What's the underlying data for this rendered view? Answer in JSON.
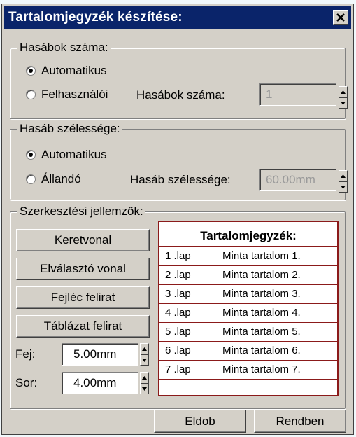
{
  "dialog": {
    "title": "Tartalomjegyzék készítése:",
    "close_label": "×"
  },
  "columns_group": {
    "label": "Hasábok száma:",
    "option_auto": "Automatikus",
    "option_user": "Felhasználói",
    "count_label": "Hasábok száma:",
    "count_value": "1",
    "selected": "Automatikus"
  },
  "width_group": {
    "label": "Hasáb szélessége:",
    "option_auto": "Automatikus",
    "option_fixed": "Állandó",
    "width_label": "Hasáb szélessége:",
    "width_value": "60.00mm",
    "selected": "Automatikus"
  },
  "edit_group": {
    "label": "Szerkesztési jellemzők:",
    "frame_line_button": "Keretvonal",
    "separator_line_button": "Elválasztó vonal",
    "header_caption_button": "Fejléc felirat",
    "table_caption_button": "Táblázat felirat",
    "head_label": "Fej:",
    "head_value": "5.00mm",
    "row_label": "Sor:",
    "row_value": "4.00mm"
  },
  "preview": {
    "title": "Tartalomjegyzék:",
    "rows": [
      {
        "page": "1 .lap",
        "content": "Minta tartalom 1."
      },
      {
        "page": "2 .lap",
        "content": "Minta tartalom 2."
      },
      {
        "page": "3 .lap",
        "content": "Minta tartalom 3."
      },
      {
        "page": "4 .lap",
        "content": "Minta tartalom 4."
      },
      {
        "page": "5 .lap",
        "content": "Minta tartalom 5."
      },
      {
        "page": "6 .lap",
        "content": "Minta tartalom 6."
      },
      {
        "page": "7 .lap",
        "content": "Minta tartalom 7."
      }
    ]
  },
  "footer": {
    "discard_button": "Eldob",
    "ok_button": "Rendben"
  },
  "colors": {
    "titlebar": "#0a246a",
    "dialog_bg": "#d4d0c8",
    "preview_border": "#8b1a1a"
  }
}
